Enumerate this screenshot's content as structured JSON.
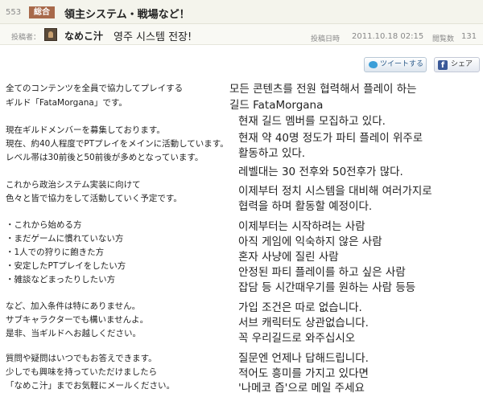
{
  "header": {
    "post_number": "553",
    "category": "総合",
    "title": "領主システム・戦場など！"
  },
  "poster": {
    "label": "投稿者：",
    "name": "なめこ汁",
    "subject": "영주 시스템 전장!",
    "posted_label": "投稿日時",
    "posted_date": "2011.10.18 02:15",
    "views_label": "閲覧数",
    "views_count": "131"
  },
  "share": {
    "tweet_label": "ツイートする",
    "facebook_label": "シェア"
  },
  "japanese_lines": [
    "全てのコンテンツを全員で協力してプレイする",
    "ギルド「FataMorgana」です。",
    "現在ギルドメンバーを募集しております。",
    "現在、約40人程度でPTプレイをメインに活動しています。",
    "レベル帯は30前後と50前後が多めとなっています。",
    "これから政治システム実装に向けて",
    "色々と皆で協力をして活動していく予定です。",
    "・これから始める方",
    "・まだゲームに慣れていない方",
    "・1人での狩りに飽きた方",
    "・安定したPTプレイをしたい方",
    "・雑談などまったりしたい方",
    "など、加入条件は特にありません。",
    "サブキャラクターでも構いませんよ。",
    "是非、当ギルドへお越しください。",
    "質問や疑問はいつでもお答えできます。",
    "少しでも興味を持っていただけましたら",
    "「なめこ汁」までお気軽にメールください。"
  ],
  "korean_lines": [
    "모든 콘텐츠를 전원 협력해서 플레이 하는",
    "길드 FataMorgana",
    "현재 길드 멤버를 모집하고 있다.",
    "현재 약 40명 정도가 파티 플레이 위주로",
    "활동하고 있다.",
    "레벨대는 30 전후와 50전후가 많다.",
    "이제부터 정치 시스템을 대비해 여러가지로",
    "협력을 하며 활동할 예정이다.",
    "이제부터는 시작하려는 사람",
    "아직 게임에 익숙하지 않은 사람",
    "혼자 사냥에 질린 사람",
    "안정된 파티 플레이를 하고 싶은 사람",
    "잡담 등 시간때우기를 원하는 사람 등등",
    "가입 조건은 따로 없습니다.",
    "서브 캐릭터도 상관없습니다.",
    "꼭 우리길드로 와주십시오",
    "질문엔 언제나 답해드립니다.",
    "적어도 흥미를 가지고 있다면",
    "'나메코 즙'으로 메일 주세요"
  ]
}
